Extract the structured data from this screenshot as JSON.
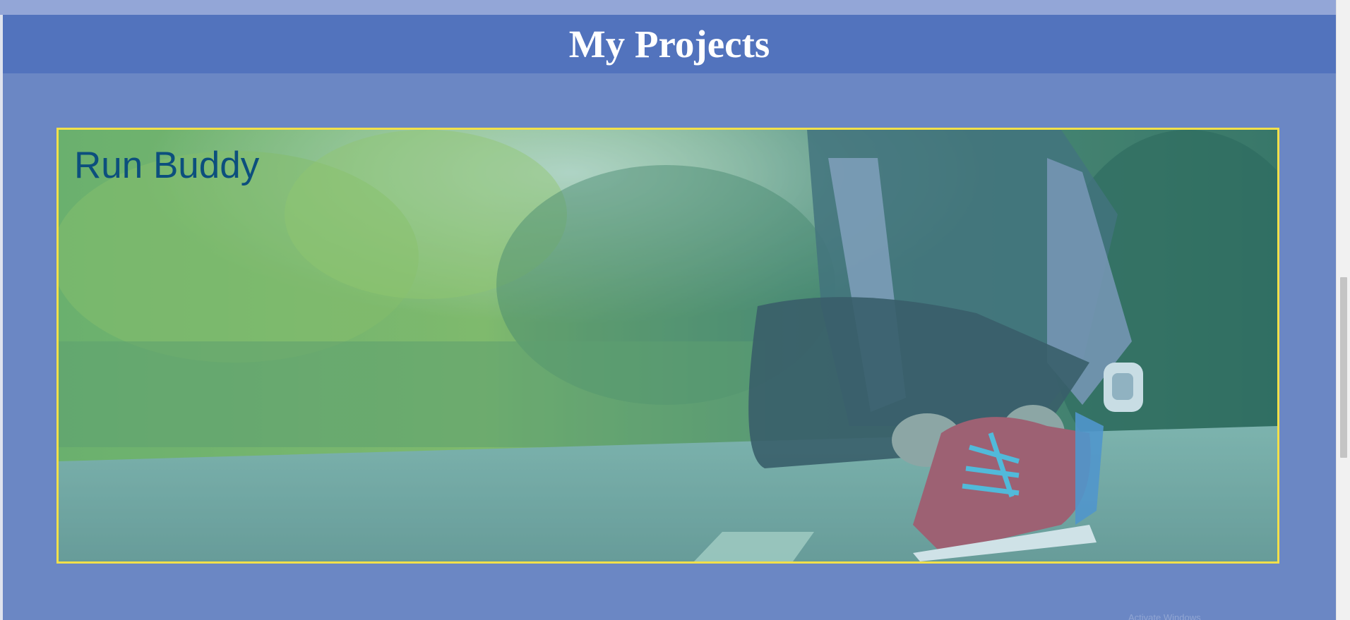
{
  "section": {
    "title": "My Projects"
  },
  "projects": [
    {
      "title": "Run Buddy",
      "image": "runner-tying-shoe-photo"
    }
  ],
  "watermark": {
    "text": "Activate Windows"
  },
  "colors": {
    "page_background": "#6b87c4",
    "header_background": "#5273bd",
    "top_strip": "#93a6d7",
    "card_border": "#f2e04a",
    "project_title": "#0c4f7d",
    "header_text": "#ffffff"
  }
}
